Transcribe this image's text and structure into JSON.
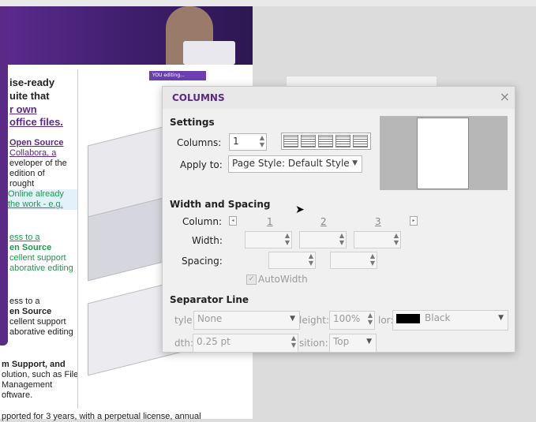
{
  "document": {
    "lines": [
      "ise-ready",
      "uite that",
      "r own",
      "office files.",
      "Open Source",
      "Collabora, a",
      "eveloper of the",
      "edition of",
      "rought",
      "Online already",
      "the work - e.g.",
      "ess to a",
      "en Source",
      "cellent support",
      "aborative editing",
      "ess to a",
      "en Source",
      "cellent support",
      "aborative editing",
      "m Support, and",
      "olution, such as File",
      "Management",
      "oftware.",
      "pported for 3 years, with a perpetual license, annual"
    ],
    "badge": "YOU editing..."
  },
  "dialog": {
    "title": "COLUMNS",
    "close_icon": "×",
    "settings": {
      "heading": "Settings",
      "columns_label": "Columns:",
      "columns_value": "1",
      "apply_label": "Apply to:",
      "apply_value": "Page Style: Default Style"
    },
    "width_spacing": {
      "heading": "Width and Spacing",
      "column_label": "Column:",
      "col_numbers": [
        "1",
        "2",
        "3"
      ],
      "width_label": "Width:",
      "spacing_label": "Spacing:",
      "autowidth_label": "AutoWidth"
    },
    "separator": {
      "heading": "Separator Line",
      "style_label": "tyle:",
      "style_value": "None",
      "height_label": "leight:",
      "height_value": "100%",
      "color_label": "lor:",
      "color_value": "Black",
      "width_label": "dth:",
      "width_value": "0.25 pt",
      "position_label": "sition:",
      "position_value": "Top"
    }
  },
  "colors": {
    "accent": "#5b2a86",
    "link_green": "#1a9b4a"
  }
}
